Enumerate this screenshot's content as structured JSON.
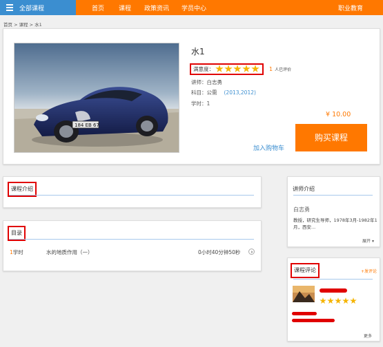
{
  "nav": {
    "all_courses": "全部课程",
    "links": [
      "首页",
      "课程",
      "政策资讯",
      "学员中心"
    ],
    "right": "职业教育"
  },
  "breadcrumb": "首页 > 课程 > 水1",
  "course": {
    "title": "水1",
    "rating_label": "满意度：",
    "stars": 5,
    "rating_count": "1",
    "rating_count_label": "人已评价",
    "teacher": "讲师：白志勇",
    "subject": "科目：公需",
    "subject_year": "(2013,2012)",
    "hours": "学时：1",
    "price": "¥ 10.00",
    "buy_label": "购买课程",
    "cart_label": "加入购物车"
  },
  "intro": {
    "heading": "课程介绍"
  },
  "catalog": {
    "heading": "目录",
    "rows": [
      {
        "num": "1",
        "unit": "学时",
        "name": "水的地质作用（一）",
        "duration": "0小时40分钟50秒"
      }
    ]
  },
  "teacher_box": {
    "heading": "讲师介绍",
    "name": "白志勇",
    "bio_line1": "教授，研究生导师，1978年3月-1982年1",
    "bio_line2": "月，西安...",
    "expand": "展开"
  },
  "comments": {
    "heading": "课程评论",
    "add": "+发评论",
    "more": "更多",
    "stars": 5
  },
  "colors": {
    "nav": "#ff7800",
    "nav_all": "#3b8ed0",
    "highlight": "#e00000",
    "star": "#f5b400"
  }
}
